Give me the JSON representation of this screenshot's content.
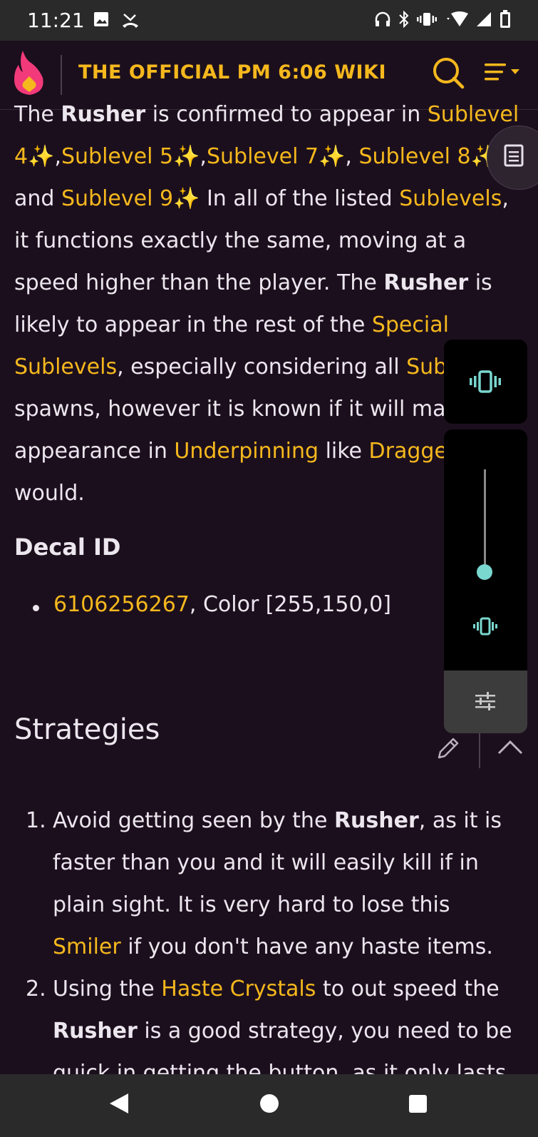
{
  "status_bar": {
    "time": "11:21",
    "icons": [
      "image-icon",
      "missed-call-icon",
      "headphones-icon",
      "bluetooth-icon",
      "vibrate-icon",
      "wifi-icon",
      "signal-icon",
      "battery-icon"
    ]
  },
  "header": {
    "title": "THE OFFICIAL PM 6:06 WIKI",
    "accent_color": "#f5b81d",
    "icons": [
      "wiki-logo-icon",
      "search-icon",
      "menu-icon"
    ]
  },
  "article": {
    "intro": {
      "t1": "The ",
      "b1": "Rusher",
      "t2": " is confirmed to appear in ",
      "l1": "Sublevel 4✨",
      "t3": ",",
      "l2": "Sublevel 5✨",
      "t4": ",",
      "l3": "Sublevel 7✨",
      "t5": ", ",
      "l4": "Sublevel 8✨",
      "t6": " and ",
      "l5": "Sublevel 9✨",
      "t7": " In all of the listed ",
      "l6": "Sublevels",
      "t8": ", it functions exactly the same, moving at a speed higher than the player. The ",
      "b2": "Rusher",
      "t9": " is likely to appear in the rest of the ",
      "l7": "Special Sublevels",
      "t10": ", especially considering all ",
      "l8": "Sub",
      "t11": " spawns, however it is known if it will ma",
      "t12": " appearance in ",
      "l9": "Underpinning",
      "t13": " like ",
      "l10": "Dragge",
      "t14": " would."
    },
    "decal": {
      "heading": "Decal ID",
      "id_link": "6106256267",
      "color_text": ", Color [255,150,0]"
    },
    "strategies": {
      "title": "Strategies",
      "items": [
        {
          "num": "1.",
          "t1": "Avoid getting seen by the ",
          "b1": "Rusher",
          "t2": ", as it is faster than you and it will easily kill if in plain sight. It is very hard to lose this ",
          "l1": "Smiler",
          "t3": " if you don't have any haste items."
        },
        {
          "num": "2.",
          "t1": "Using the ",
          "l1": "Haste Crystals",
          "t2": " to out speed the ",
          "b1": "Rusher",
          "t3": " is a good strategy, you need to be quick in getting the button, as it only lasts"
        }
      ]
    }
  },
  "volume_panel": {
    "level": 0.0,
    "icons": [
      "vibrate-mode-icon",
      "vibrate-icon",
      "equalizer-settings-icon"
    ]
  },
  "nav_bar": {
    "icons": [
      "back-icon",
      "home-icon",
      "recents-icon"
    ]
  }
}
